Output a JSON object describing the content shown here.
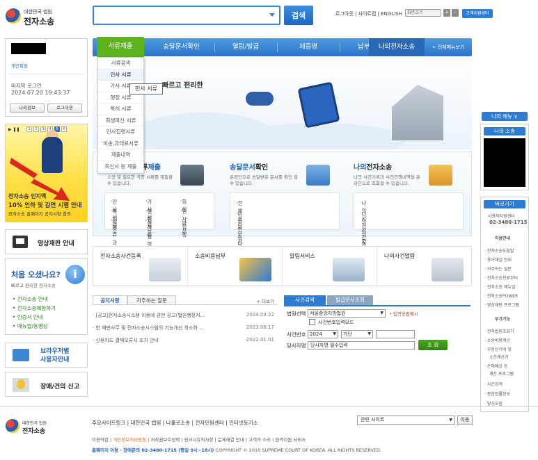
{
  "header": {
    "logo_org": "대한민국 법원",
    "logo_name": "전자소송",
    "search_value": "",
    "search_button": "검색",
    "toplinks": "로그아웃 | 사이트맵 | ENGLISH",
    "zoom_label": "화면크기",
    "zoom_plus": "+",
    "zoom_minus": "-",
    "help_button": "고객지원센터"
  },
  "nav": {
    "items": [
      "서류제출",
      "송달문서확인",
      "열람/발급",
      "제증명",
      "납부/환급",
      "나의전자소송"
    ],
    "all_menu": "+ 전체메뉴보기"
  },
  "dropdown": [
    "서류검색",
    "민사 서류",
    "가사 서류",
    "행정 서류",
    "특허 서류",
    "회생파산 서류",
    "민사집행서류",
    "비송,과태료서류",
    "제출내역",
    "회신서 등 제출"
  ],
  "tooltip": "민사 서류",
  "login": {
    "dept": "개인회원",
    "last_login_label": "마지막 로그인",
    "last_login_time": "2024.07.20 19:43:37",
    "myinfo": "나의정보",
    "logout": "로그아웃"
  },
  "banner": {
    "pages": [
      "1",
      "2",
      "3",
      "4",
      "5",
      "6"
    ],
    "active_page": 5,
    "line1": "전자소송 인지액",
    "line2": "10% 인하 및 감면 시행 안내",
    "line3": "전자소송 홈페이지 공지사항 참조"
  },
  "video": "영상재판 안내",
  "first": {
    "title": "처음 오셨나요?",
    "sub": "빠르고 편리한 전자소송",
    "icon": "i",
    "links": [
      "전자소송 안내",
      "전자소송체험하기",
      "인증서 안내",
      "매뉴얼/동영상"
    ]
  },
  "browser": {
    "line1": "브라우저별",
    "line2": "사용자안내"
  },
  "fault": "장애/건의 신고",
  "hero": {
    "text": "빠르고 편리한"
  },
  "services": [
    {
      "title_a": "서류",
      "title_b": "제출",
      "desc": "소장 및 필요한 각종 서류를 제출할 수 있습니다.",
      "items": [
        "민사 서류",
        "가사 서류",
        "회생·파산",
        "특허 서류",
        "행정 서류",
        "민사집행",
        "비송·과태료",
        "지급 명령"
      ]
    },
    {
      "title_a": "송달문서",
      "title_b": "확인",
      "desc": "온라인으로 송달받은 문서를 확인 할 수 있습니다.",
      "items": [
        "전체송달문서",
        "미확인송달문서"
      ]
    },
    {
      "title_a": "나의",
      "title_b": "전자소송",
      "desc": "나의 사건기록과 사건진행내역을 온라인으로 조회할 수 있습니다.",
      "items": [
        "나의사건현황",
        "나의사건관리"
      ]
    }
  ],
  "quick": [
    "전자소송사건등록",
    "소송비용납부",
    "알림서비스",
    "나의사건열람"
  ],
  "notice": {
    "tabs": [
      "공지사항",
      "자주하는 질문"
    ],
    "more": "+ 더보기",
    "rows": [
      {
        "title": "· [공고]전자소송시스템 이용에 관한 공고(법원행정처...",
        "date": "2024.03.22"
      },
      {
        "title": "· 헌 재판사무 및 전자소송시스템의 기능개선 최소화 ...",
        "date": "2023.06.17"
      },
      {
        "title": "· 신용카드 결제오류시 조치 안내",
        "date": "2022.01.01"
      }
    ]
  },
  "case": {
    "tabs": [
      "사건검색",
      "발급문서조회"
    ],
    "court_label": "법원선택",
    "court_value": "서울중앙지방법원",
    "input_help": "입력방법예시",
    "checkbox_label": "사건번호입력모드",
    "number_label": "사건번호",
    "year": "2024",
    "gubun": "가단",
    "party_label": "당사자명",
    "party_placeholder": "당사자명 필수입력",
    "search": "조 회"
  },
  "right": {
    "mymenu": "나의 메뉴 ∨",
    "mysosong": "나의 소송",
    "shortcut": "바로가기",
    "center_name": "사용자지원센터",
    "center_phone": "02-3480-1715",
    "usage_title": "이용안내",
    "usage_items": [
      "전자소송도움말",
      "용어해설 안내",
      "자주하는 질문",
      "전자소송진료부터",
      "전자소송 매뉴얼",
      "전자소송POWER",
      "영상재판 프로그램"
    ],
    "extra_title": "부가기능",
    "extra_items": [
      "전자법원조회기",
      "소송비용계산",
      "부동산기여 및",
      "소가계산기",
      "손해배상 등",
      "계산 프로그램",
      "사건검색",
      "종합법률정보",
      "양식모음"
    ]
  },
  "footer": {
    "org": "대한민국 법원",
    "name": "전자소송",
    "links": "주요사이트링크 | 대한민국 법원 | 나홀로소송 | 전자민원센터 | 인터넷등기소",
    "select": "관련 사이트",
    "go": "이동",
    "line2a": "이용약관 | ",
    "line2b": "개인정보처리방침",
    "line2c": " | 저작권보호정책 | 링크시유의사항 | 문제해결 안내 | 고객의 소리 | 원격지원 서비스",
    "line3a": "홈페이지 이용 · 장애문의 02-3480-1715 (평일 9시~18시)",
    "line3b": "   COPYRIGHT © 2010 SUPREME COURT OF KOREA. ALL RIGHTS RESERVED."
  }
}
